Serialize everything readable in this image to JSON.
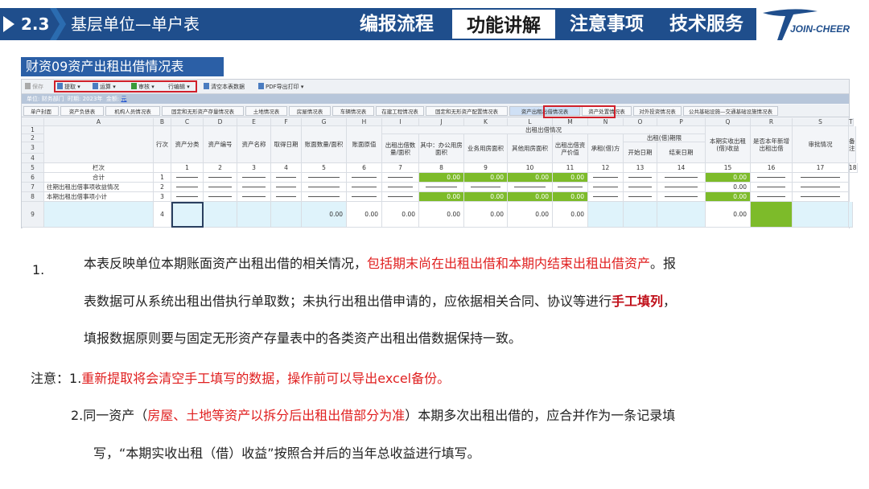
{
  "header": {
    "section_num": "2.3",
    "title": "基层单位—单户表",
    "nav": [
      "编报流程",
      "功能讲解",
      "注意事项",
      "技术服务"
    ],
    "active_nav": "功能讲解",
    "logo_text": "JOIN-CHEER",
    "accent": "#1f4e8c"
  },
  "subtitle": "财资09资产出租出借情况表",
  "app": {
    "toolbar": {
      "save": "保存",
      "fetch": "提取",
      "calc": "运算",
      "audit": "审核",
      "rowop": "行编辑",
      "clear": "清空本表数据",
      "pdf": "PDF导出打印"
    },
    "info": {
      "unit_label": "单位:",
      "unit_value": "财务部门",
      "period_label": "时期:",
      "period_value": "2023年",
      "amount_label": "金额:",
      "amount_value": "元"
    },
    "tabs": [
      "单户封面",
      "资产负债表",
      "机构人员情况表",
      "固定和无形资产存量情况表",
      "土地情况表",
      "房屋情况表",
      "车辆情况表",
      "在建工程情况表",
      "固定和无形资产配置情况表",
      "资产出租出借情况表",
      "资产处置情况表",
      "对外投资情况表",
      "公共基础设施—交通基础设施情况表"
    ],
    "selected_tab": "资产出租出借情况表",
    "cols": [
      "A",
      "B",
      "C",
      "D",
      "E",
      "F",
      "G",
      "H",
      "I",
      "J",
      "K",
      "L",
      "M",
      "N",
      "O",
      "P",
      "Q",
      "R",
      "S",
      "T"
    ],
    "h_group": "出租出借情况",
    "h_sub_period": "出租(借)期限",
    "headers": {
      "item": "",
      "lineno": "行次",
      "cls": "资产分类",
      "code": "资产编号",
      "name": "资产名称",
      "date": "取得日期",
      "qty": "账面数量/面积",
      "val": "账面原值",
      "area": "出租出借数量/面积",
      "office": "其中：办公用房面积",
      "biz": "业务用房面积",
      "other": "其他用房面积",
      "value": "出租出借资产价值",
      "party": "承租(借)方",
      "start": "开始日期",
      "end": "结束日期",
      "income": "本期实收出租(借)收益",
      "ended": "是否本年新增出租出借",
      "approval": "审批情况",
      "note": "备注"
    },
    "colnums": [
      "栏次",
      "",
      "1",
      "2",
      "3",
      "4",
      "5",
      "6",
      "7",
      "8",
      "9",
      "10",
      "11",
      "12",
      "13",
      "14",
      "15",
      "16",
      "17",
      "18"
    ],
    "rows": [
      {
        "label": "合计",
        "no": "1",
        "vals": [
          "0.00",
          "0.00",
          "0.00",
          "0.00",
          "0.00"
        ]
      },
      {
        "label": "往期出租出借事项收益情况",
        "no": "2",
        "vals": [
          "0.00"
        ]
      },
      {
        "label": "本期出租出借事项小计",
        "no": "3",
        "vals": [
          "0.00",
          "0.00",
          "0.00",
          "0.00",
          "0.00"
        ]
      },
      {
        "label": "",
        "no": "4",
        "vals": [
          "0.00",
          "0.00",
          "0.00",
          "0.00",
          "0.00",
          "0.00",
          "0.00",
          "0.00"
        ]
      }
    ],
    "row_nums": [
      "1",
      "2",
      "3",
      "4",
      "5",
      "6",
      "7",
      "8",
      "9"
    ]
  },
  "notes": {
    "n1_num": "1.",
    "n1_a": "本表反映单位本期账面资产出租出借的相关情况，",
    "n1_b": "包括期末尚在出租出借和本期内结束出租出借资产",
    "n1_c": "。报",
    "n1_d": "表数据可从系统出租出借执行单取数；未执行出租出借申请的，应依据相关合同、协议等进行",
    "n1_e": "手工填列",
    "n1_f": "，",
    "n1_g": "填报数据原则要与固定无形资产存量表中的各类资产出租出借数据保持一致。",
    "warn_label": "注意：",
    "w1_a": "1.",
    "w1_b": "重新提取将会清空手工填写的数据，操作前可以导出excel备份。",
    "w2_a": "2.同一资产（",
    "w2_b": "房屋、土地等资产以拆分后出租出借部分为准",
    "w2_c": "）本期多次出租出借的，应合并作为一条记录填",
    "w2_d": "写，“本期实收出租（借）收益”按照合并后的当年总收益进行填写。"
  }
}
